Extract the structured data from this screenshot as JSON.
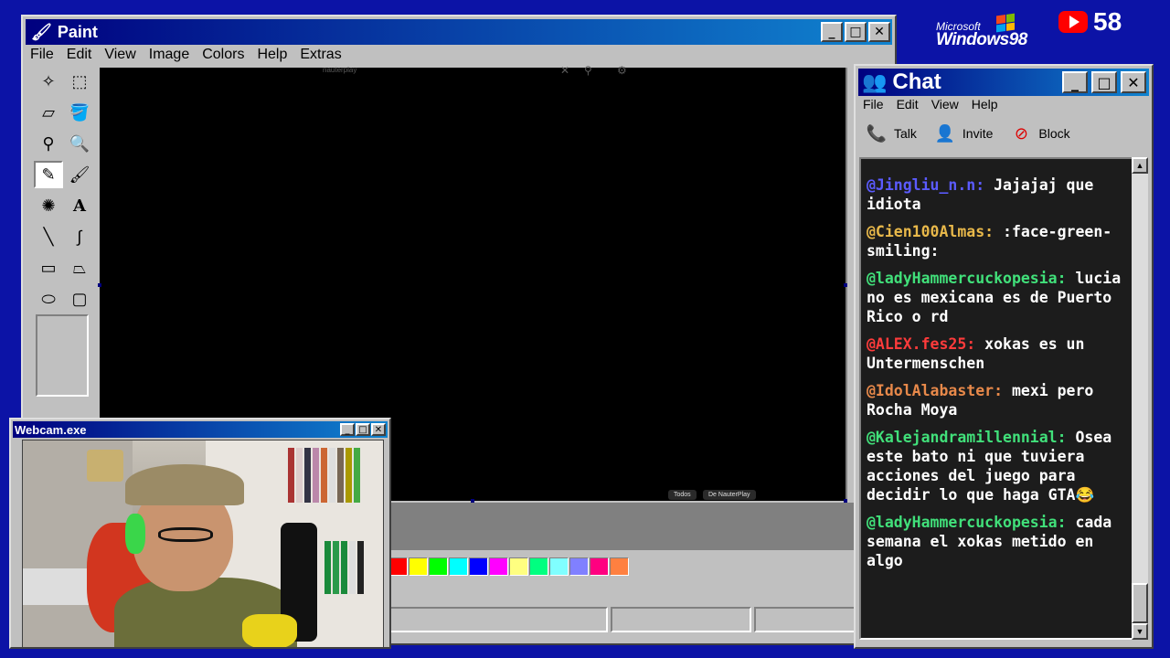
{
  "paint": {
    "title": "Paint",
    "menu": [
      "File",
      "Edit",
      "View",
      "Image",
      "Colors",
      "Help",
      "Extras"
    ],
    "canvas": {
      "ghost_text": "nauterplay",
      "chip_all": "Todos",
      "chip_from": "De NauterPlay"
    },
    "palette": [
      "#ff0000",
      "#ffff00",
      "#00ff00",
      "#00ffff",
      "#0000ff",
      "#ff00ff",
      "#ffff80",
      "#00ff80",
      "#80ffff",
      "#8080ff",
      "#ff0080",
      "#ff8040"
    ]
  },
  "webcam": {
    "title": "Webcam.exe"
  },
  "chat": {
    "title": "Chat",
    "menu": [
      "File",
      "Edit",
      "View",
      "Help"
    ],
    "toolbar": {
      "talk": "Talk",
      "invite": "Invite",
      "block": "Block"
    },
    "messages": [
      {
        "user": "@Jingliu_n.n:",
        "color": "#5b5bff",
        "text": "Jajajaj que idiota"
      },
      {
        "user": "@Cien100Almas:",
        "color": "#e8b84a",
        "text": ":face-green-smiling:"
      },
      {
        "user": "@ladyHammercuckopesia:",
        "color": "#41e07a",
        "text": "lucia no es mexicana es de Puerto Rico o rd"
      },
      {
        "user": "@ALEX.fes25:",
        "color": "#ff3b3b",
        "text": "xokas es un Untermenschen"
      },
      {
        "user": "@IdolAlabaster:",
        "color": "#e8894a",
        "text": "mexi pero Rocha Moya"
      },
      {
        "user": "@Kalejandramillennial:",
        "color": "#41e07a",
        "text": "Osea este bato ni que tuviera acciones del juego para decidir lo que haga GTA😂"
      },
      {
        "user": "@ladyHammercuckopesia:",
        "color": "#41e07a",
        "text": "cada semana el xokas metido en algo"
      }
    ]
  },
  "brand": {
    "microsoft": "Microsoft",
    "windows": "Windows98",
    "youtube_count": "58"
  },
  "colors": {
    "desktop": "#0c13a6",
    "title_start": "#00007f",
    "title_end": "#1084d0",
    "win_face": "#c0c0c0"
  }
}
